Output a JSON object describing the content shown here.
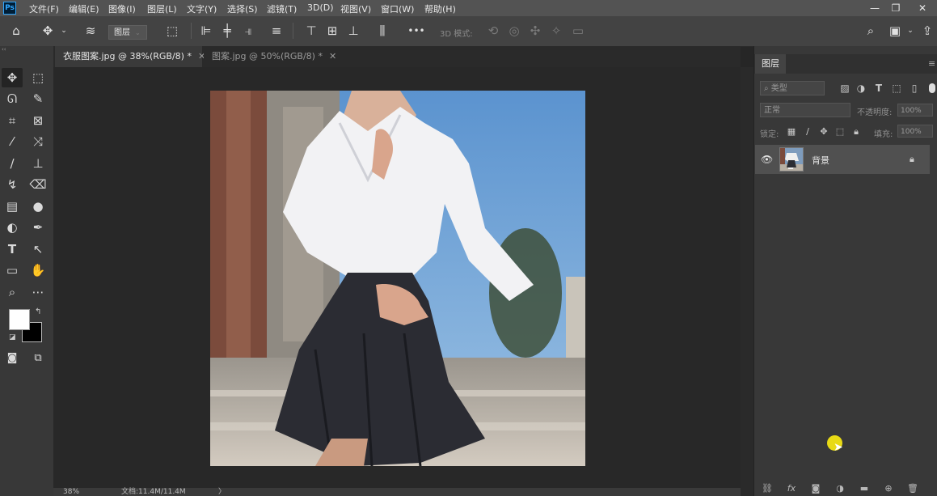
{
  "app": {
    "logo_text": "Ps"
  },
  "menu": [
    "文件(F)",
    "编辑(E)",
    "图像(I)",
    "图层(L)",
    "文字(Y)",
    "选择(S)",
    "滤镜(T)",
    "3D(D)",
    "视图(V)",
    "窗口(W)",
    "帮助(H)"
  ],
  "window_controls": {
    "minimize": "—",
    "restore": "❐",
    "close": "✕"
  },
  "options": {
    "layer_select": "图层",
    "mode_3d_label": "3D 模式:",
    "more": "•••"
  },
  "tabs": [
    {
      "label": "衣服图案.jpg @ 38%(RGB/8) *",
      "close": "✕"
    },
    {
      "label": "图案.jpg @ 50%(RGB/8) *",
      "close": "✕"
    }
  ],
  "status": {
    "zoom": "38%",
    "doc_info": "文档:11.4M/11.4M",
    "arrow": "〉"
  },
  "layers_panel": {
    "tab_label": "图层",
    "filter_placeholder": "类型",
    "blend_mode": "正常",
    "opacity_label": "不透明度:",
    "opacity_value": "100%",
    "lock_label": "锁定:",
    "fill_label": "填充:",
    "fill_value": "100%",
    "layers": [
      {
        "name": "背景",
        "visible": true,
        "locked": true
      }
    ]
  },
  "colors": {
    "foreground": "#ffffff",
    "background": "#000000",
    "accent_cursor": "#f1e313"
  },
  "icons": {
    "menu_collapse": "‹‹",
    "toolbar_collapse": "‹‹"
  }
}
